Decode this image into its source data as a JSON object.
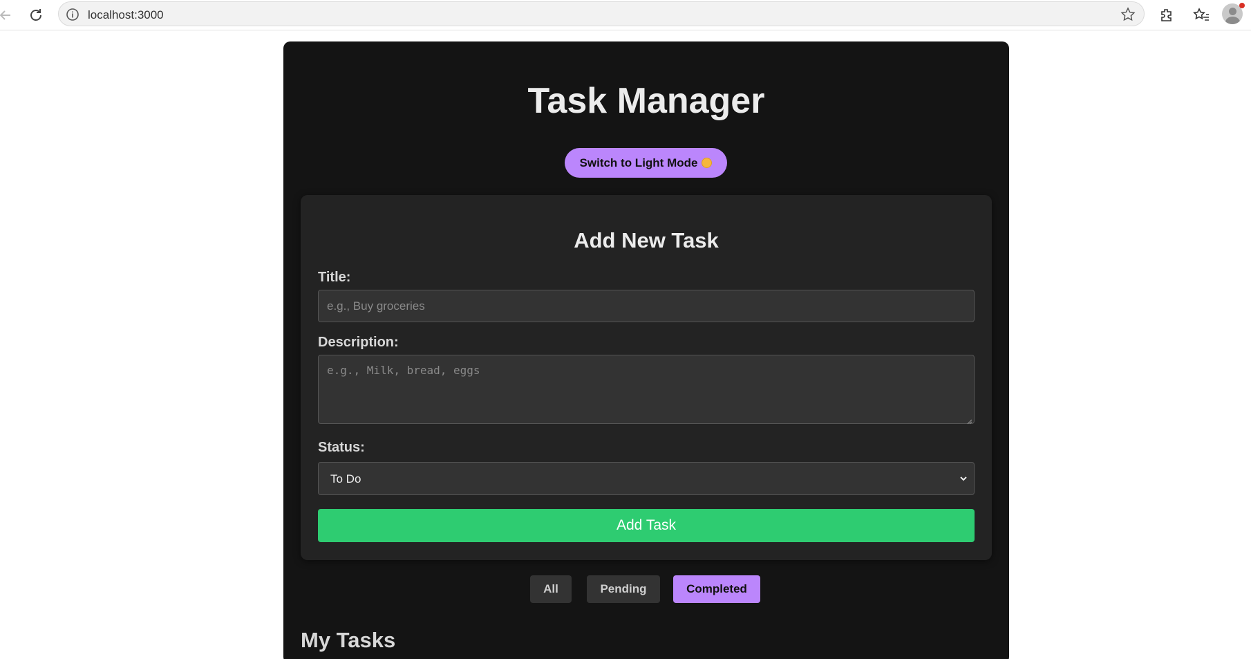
{
  "browser": {
    "url": "localhost:3000"
  },
  "app": {
    "title": "Task Manager",
    "theme_toggle_label": "Switch to Light Mode"
  },
  "form": {
    "heading": "Add New Task",
    "title_label": "Title:",
    "title_placeholder": "e.g., Buy groceries",
    "title_value": "",
    "description_label": "Description:",
    "description_placeholder": "e.g., Milk, bread, eggs",
    "description_value": "",
    "status_label": "Status:",
    "status_selected": "To Do",
    "submit_label": "Add Task"
  },
  "filters": {
    "all_label": "All",
    "pending_label": "Pending",
    "completed_label": "Completed",
    "active": "Completed"
  },
  "tasks": {
    "section_title": "My Tasks"
  },
  "colors": {
    "accent": "#bb86fc",
    "success": "#2ecc71",
    "background": "#141414",
    "card": "#232323"
  },
  "icons": [
    "back-arrow-icon",
    "reload-icon",
    "site-info-icon",
    "bookmark-star-icon",
    "extensions-icon",
    "favorites-icon",
    "profile-avatar",
    "sun-icon",
    "chevron-down-icon"
  ]
}
